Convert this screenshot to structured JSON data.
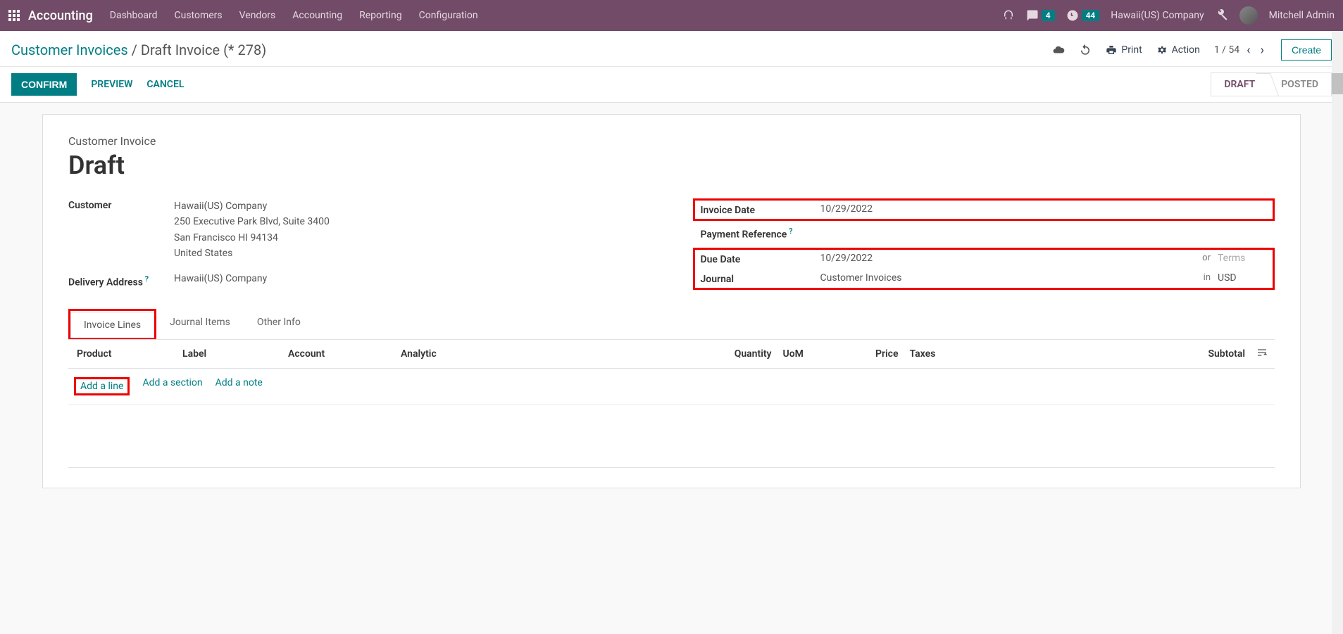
{
  "topnav": {
    "brand": "Accounting",
    "items": [
      "Dashboard",
      "Customers",
      "Vendors",
      "Accounting",
      "Reporting",
      "Configuration"
    ],
    "chat_badge": "4",
    "clock_badge": "44",
    "company": "Hawaii(US) Company",
    "user": "Mitchell Admin"
  },
  "breadcrumb": {
    "parent": "Customer Invoices",
    "current": "Draft Invoice (* 278)"
  },
  "subbar": {
    "print": "Print",
    "action": "Action",
    "pager": "1 / 54",
    "create": "Create"
  },
  "actionbar": {
    "confirm": "CONFIRM",
    "preview": "PREVIEW",
    "cancel": "CANCEL",
    "status_draft": "DRAFT",
    "status_posted": "POSTED"
  },
  "doc": {
    "label": "Customer Invoice",
    "title": "Draft"
  },
  "form": {
    "customer_label": "Customer",
    "customer_name": "Hawaii(US) Company",
    "customer_addr1": "250 Executive Park Blvd, Suite 3400",
    "customer_addr2": "San Francisco HI 94134",
    "customer_addr3": "United States",
    "delivery_label": "Delivery Address",
    "delivery_value": "Hawaii(US) Company",
    "invoice_date_label": "Invoice Date",
    "invoice_date_value": "10/29/2022",
    "payment_ref_label": "Payment Reference",
    "due_date_label": "Due Date",
    "due_date_value": "10/29/2022",
    "or_text": "or",
    "terms_placeholder": "Terms",
    "journal_label": "Journal",
    "journal_value": "Customer Invoices",
    "in_text": "in",
    "currency": "USD"
  },
  "tabs": {
    "invoice_lines": "Invoice Lines",
    "journal_items": "Journal Items",
    "other_info": "Other Info"
  },
  "table": {
    "product": "Product",
    "label": "Label",
    "account": "Account",
    "analytic": "Analytic",
    "quantity": "Quantity",
    "uom": "UoM",
    "price": "Price",
    "taxes": "Taxes",
    "subtotal": "Subtotal"
  },
  "actions": {
    "add_line": "Add a line",
    "add_section": "Add a section",
    "add_note": "Add a note"
  }
}
